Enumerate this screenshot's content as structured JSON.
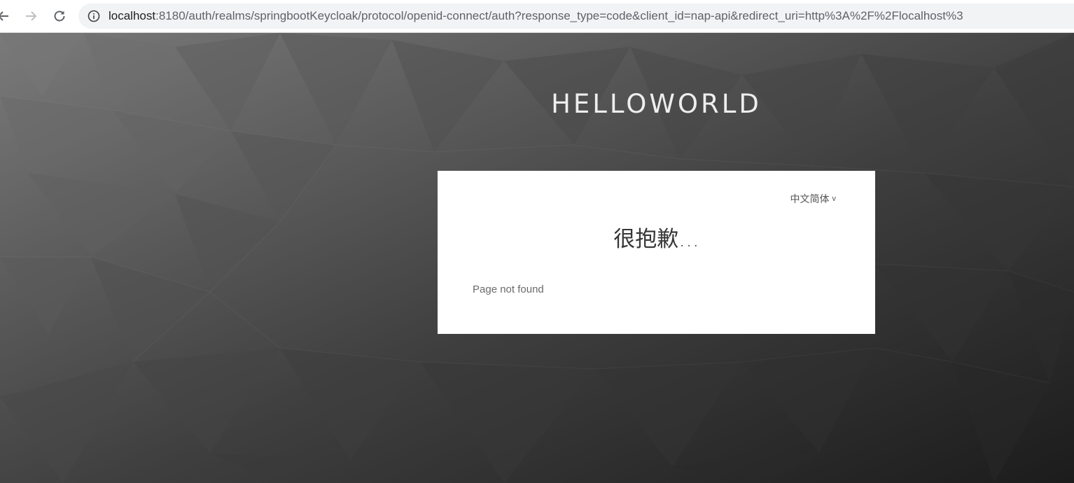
{
  "browser": {
    "url_host": "localhost",
    "url_rest": ":8180/auth/realms/springbootKeycloak/protocol/openid-connect/auth?response_type=code&client_id=nap-api&redirect_uri=http%3A%2F%2Flocalhost%3",
    "icons": [
      "back-arrow-icon",
      "forward-arrow-icon",
      "reload-icon",
      "info-icon"
    ]
  },
  "page": {
    "realm_title": "HELLOWORLD",
    "locale": {
      "label": "中文简体",
      "chevron": "v"
    },
    "card_title": "很抱歉...",
    "message": "Page not found"
  },
  "colors": {
    "background_light": "#7a7a7a",
    "background_dark": "#1e1e1e",
    "card_bg": "#ffffff",
    "title_color": "#eeeeee"
  }
}
